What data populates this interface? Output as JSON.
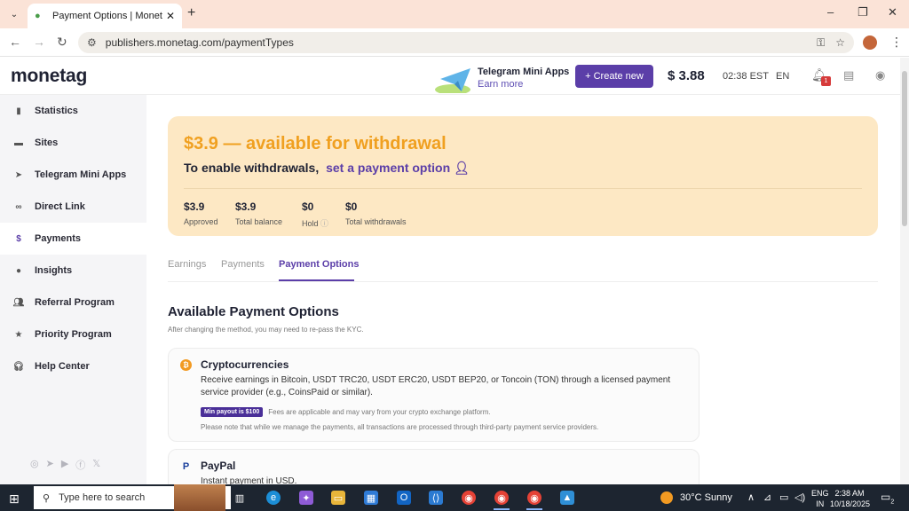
{
  "browser": {
    "tab_title": "Payment Options | Monetag.co",
    "url": "publishers.monetag.com/paymentTypes"
  },
  "header": {
    "logo": "monetag",
    "promo_title": "Telegram Mini Apps",
    "promo_link": "Earn more",
    "create_button": "+ Create new",
    "balance": "$ 3.88",
    "time": "02:38 EST",
    "language": "EN",
    "notification_count": "1"
  },
  "sidebar": {
    "items": [
      {
        "label": "Statistics",
        "icon": "bar-chart-icon"
      },
      {
        "label": "Sites",
        "icon": "sites-icon"
      },
      {
        "label": "Telegram Mini Apps",
        "icon": "telegram-icon"
      },
      {
        "label": "Direct Link",
        "icon": "link-icon"
      },
      {
        "label": "Payments",
        "icon": "dollar-icon"
      },
      {
        "label": "Insights",
        "icon": "question-icon"
      },
      {
        "label": "Referral Program",
        "icon": "people-icon"
      },
      {
        "label": "Priority Program",
        "icon": "star-icon"
      },
      {
        "label": "Help Center",
        "icon": "headset-icon"
      }
    ]
  },
  "banner": {
    "amount_text": "$3.9 — available for withdrawal",
    "enable_text": "To enable withdrawals,",
    "enable_link": "set a payment option",
    "stats": [
      {
        "value": "$3.9",
        "label": "Approved"
      },
      {
        "value": "$3.9",
        "label": "Total balance"
      },
      {
        "value": "$0",
        "label": "Hold"
      },
      {
        "value": "$0",
        "label": "Total withdrawals"
      }
    ]
  },
  "tabs": [
    {
      "label": "Earnings"
    },
    {
      "label": "Payments"
    },
    {
      "label": "Payment Options"
    }
  ],
  "section": {
    "title": "Available Payment Options",
    "hint": "After changing the method, you may need to re-pass the KYC."
  },
  "cards": [
    {
      "title": "Cryptocurrencies",
      "desc": "Receive earnings in Bitcoin, USDT TRC20, USDT ERC20, USDT BEP20, or Toncoin (TON) through a licensed payment service provider (e.g., CoinsPaid or similar).",
      "badge": "Min payout is $100",
      "badge_note": "Fees are applicable and may vary from your crypto exchange platform.",
      "note": "Please note that while we manage the payments, all transactions are processed through third-party payment service providers."
    },
    {
      "title": "PayPal",
      "desc": "Instant payment in USD."
    }
  ],
  "taskbar": {
    "search_placeholder": "Type here to search",
    "weather": "30°C  Sunny",
    "lang_line1": "ENG",
    "lang_line2": "IN",
    "time": "2:38 AM",
    "date": "10/18/2025",
    "notif_count": "2"
  }
}
